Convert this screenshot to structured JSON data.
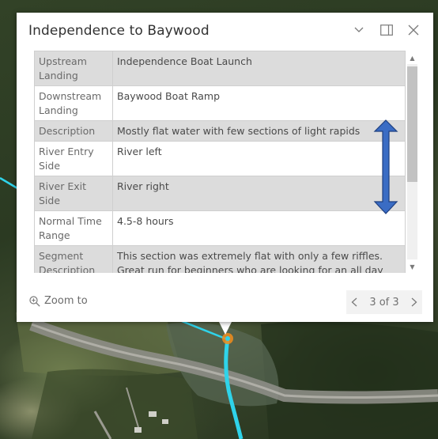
{
  "popup": {
    "title": "Independence to Baywood",
    "header_icons": [
      "chevron-down-icon",
      "dock-icon",
      "close-icon"
    ],
    "rows": [
      {
        "label": "Upstream Landing",
        "value": "Independence Boat Launch"
      },
      {
        "label": "Downstream Landing",
        "value": "Baywood Boat Ramp"
      },
      {
        "label": "Description",
        "value": "Mostly flat water with few sections of light rapids"
      },
      {
        "label": "River Entry Side",
        "value": "River left"
      },
      {
        "label": "River Exit Side",
        "value": "River right"
      },
      {
        "label": "Normal Time Range",
        "value": "4.5-8 hours"
      },
      {
        "label": "Segment Description",
        "value": "This section was extremely flat with only a few riffles. Great run for beginners who are looking for an all day"
      }
    ],
    "footer": {
      "zoom_label": "Zoom to",
      "pager_label": "3 of 3"
    }
  },
  "colors": {
    "river": "#2fd3ea",
    "annotation_arrow": "#2f5fb3",
    "selected_marker": "#f28c1c"
  }
}
